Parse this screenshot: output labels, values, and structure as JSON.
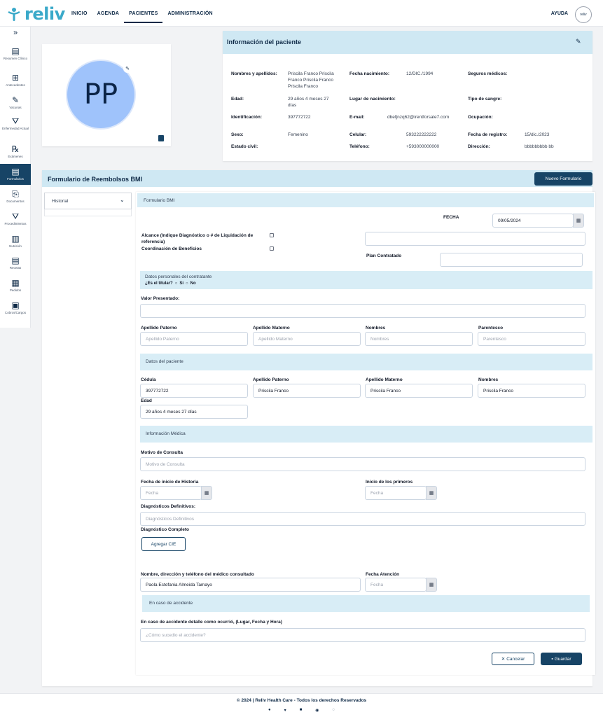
{
  "brand": {
    "name": "reliv",
    "avatar_text": "reliv"
  },
  "nav": {
    "items": [
      "INICIO",
      "AGENDA",
      "PACIENTES",
      "ADMINISTRACIÓN"
    ],
    "help": "AYUDA"
  },
  "sidebar": {
    "expand": "»",
    "items": [
      {
        "label": "Resumen Clínico",
        "icon": "▤"
      },
      {
        "label": "Antecedentes",
        "icon": "⊞"
      },
      {
        "label": "Vacunas",
        "icon": "✎"
      },
      {
        "label": "Enfermedad Actual",
        "icon": "⛛"
      },
      {
        "label": "Exámenes",
        "icon": "℞"
      },
      {
        "label": "Formularios",
        "icon": "▤"
      },
      {
        "label": "Documentos",
        "icon": "⎘"
      },
      {
        "label": "Procedimientos",
        "icon": "⛛"
      },
      {
        "label": "Nutrición",
        "icon": "▥"
      },
      {
        "label": "Recetas",
        "icon": "▤"
      },
      {
        "label": "Pedidos",
        "icon": "▦"
      },
      {
        "label": "Cobros/Cargos",
        "icon": "▣"
      }
    ]
  },
  "patient": {
    "initials": "PP",
    "card_title": "Información del paciente",
    "fields": {
      "nombres_label": "Nombres y apellidos:",
      "nombres_value": "Priscila Franco Priscila Franco Priscila Franco Priscila Franco",
      "fecha_nac_label": "Fecha nacimiento:",
      "fecha_nac_value": "12/DIC./1994",
      "seguros_label": "Seguros médicos:",
      "edad_label": "Edad:",
      "edad_value": "29 años 4 meses 27 días",
      "lugar_label": "Lugar de nacimiento:",
      "sangre_label": "Tipo de sangre:",
      "ident_label": "Identificación:",
      "ident_value": "397772722",
      "email_label": "E-mail:",
      "email_value": "dbefjnzq62@irentforsale7.com",
      "ocup_label": "Ocupación:",
      "sexo_label": "Sexo:",
      "sexo_value": "Femenino",
      "celular_label": "Celular:",
      "celular_value": "593222222222",
      "registro_label": "Fecha de registro:",
      "registro_value": "15/dic./2023",
      "civil_label": "Estado civil:",
      "telefono_label": "Teléfono:",
      "telefono_value": "+593000000000",
      "direccion_label": "Dirección:",
      "direccion_value": "bbbbbbbbb bb"
    }
  },
  "form": {
    "section_title": "Formulario de Reembolsos BMI",
    "new_button": "Nuevo Formulario",
    "history_label": "Historial",
    "inner_title": "Formulario BMI",
    "fecha_label": "FECHA",
    "fecha_value": "09/05/2024",
    "alcance_label": "Alcance (Indique Diagnóstico o # de Liquidación de referencia)",
    "coordinacion_label": "Coordinación de Beneficios",
    "plan_label": "Plan Contratado",
    "contratante_band": "Datos personales del contratante",
    "titular_question": "¿Es el titular?",
    "titular_si": "Si",
    "titular_no": "No",
    "valor_label": "Valor Presentado:",
    "contratante": {
      "apellido_paterno_label": "Apellido Paterno",
      "apellido_paterno_ph": "Apellido Paterno",
      "apellido_materno_label": "Apellido Materno",
      "apellido_materno_ph": "Apellido Materno",
      "nombres_label": "Nombres",
      "nombres_ph": "Nombres",
      "parentesco_label": "Parentesco",
      "parentesco_ph": "Parentesco"
    },
    "paciente_band": "Datos del paciente",
    "paciente": {
      "cedula_label": "Cédula",
      "cedula_value": "397772722",
      "ap_paterno_label": "Apellido Paterno",
      "ap_paterno_value": "Priscila Franco",
      "ap_materno_label": "Apellido Materno",
      "ap_materno_value": "Priscila Franco",
      "nombres_label": "Nombres",
      "nombres_value": "Priscila Franco",
      "edad_label": "Edad",
      "edad_value": "29 años 4 meses 27 días"
    },
    "medica_band": "Información Médica",
    "medica": {
      "motivo_label": "Motivo de Consulta",
      "motivo_ph": "Motivo de Consulta",
      "inicio_historia_label": "Fecha de inicio de Historia",
      "inicio_historia_ph": "Fecha",
      "inicio_primeros_label": "Inicio de los primeros",
      "inicio_primeros_ph": "Fecha",
      "diag_def_label": "Diagnósticos Definitivos:",
      "diag_def_ph": "Diagnósticos Definitivos",
      "diag_completo_label": "Diagnóstico Completo",
      "agregar_cie": "Agregar CIE",
      "medico_label": "Nombre, dirección y teléfono del médico consultado",
      "medico_value": "Paola Estefania Almeida Tamayo",
      "fecha_atencion_label": "Fecha Atención",
      "fecha_atencion_ph": "Fecha"
    },
    "accidente_band": "En caso de accidente",
    "accidente_label": "En caso de accidente detalle como ocurrió, (Lugar, Fecha y Hora)",
    "accidente_ph": "¿Cómo sucedio el accidente?",
    "cancel": "Cancelar",
    "save": "Guardar"
  },
  "footer": {
    "copyright": "© 2024 | Reliv Health Care - Todos los derechos Reservados",
    "social": [
      "facebook-icon",
      "twitter-icon",
      "linkedin-icon",
      "globe-icon",
      "whatsapp-icon"
    ]
  }
}
